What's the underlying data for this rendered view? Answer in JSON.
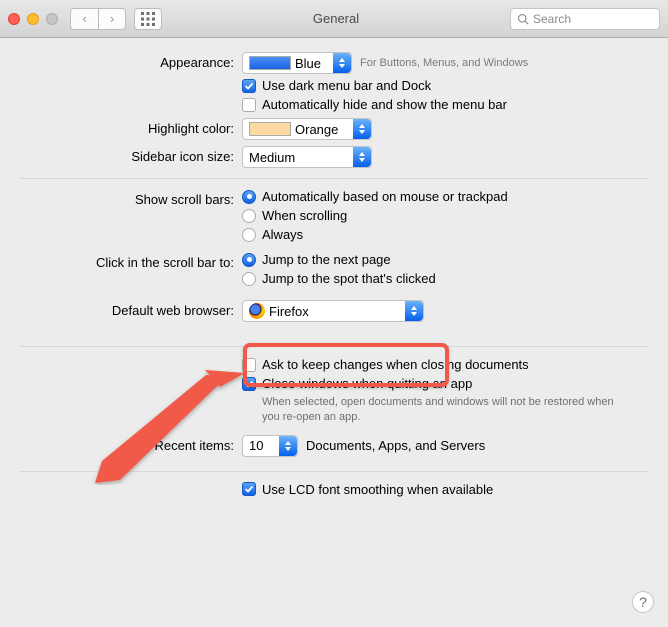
{
  "window": {
    "title": "General"
  },
  "search": {
    "placeholder": "Search"
  },
  "labels": {
    "appearance": "Appearance:",
    "highlight": "Highlight color:",
    "sidebar": "Sidebar icon size:",
    "scrollbars": "Show scroll bars:",
    "clickscroll": "Click in the scroll bar to:",
    "browser": "Default web browser:",
    "recent": "Recent items:"
  },
  "appearance": {
    "value": "Blue",
    "hint": "For Buttons, Menus, and Windows",
    "dark_menu": "Use dark menu bar and Dock",
    "autohide_menu": "Automatically hide and show the menu bar"
  },
  "highlight": {
    "value": "Orange"
  },
  "sidebar": {
    "value": "Medium"
  },
  "scroll": {
    "auto": "Automatically based on mouse or trackpad",
    "when": "When scrolling",
    "always": "Always"
  },
  "click": {
    "jump_next": "Jump to the next page",
    "jump_spot": "Jump to the spot that's clicked"
  },
  "browser": {
    "value": "Firefox"
  },
  "docs": {
    "ask": "Ask to keep changes when closing documents",
    "closewin": "Close windows when quitting an app",
    "closewin_sub": "When selected, open documents and windows will not be restored when you re-open an app."
  },
  "recent": {
    "value": "10",
    "suffix": "Documents, Apps, and Servers"
  },
  "lcd": "Use LCD font smoothing when available",
  "help": "?"
}
